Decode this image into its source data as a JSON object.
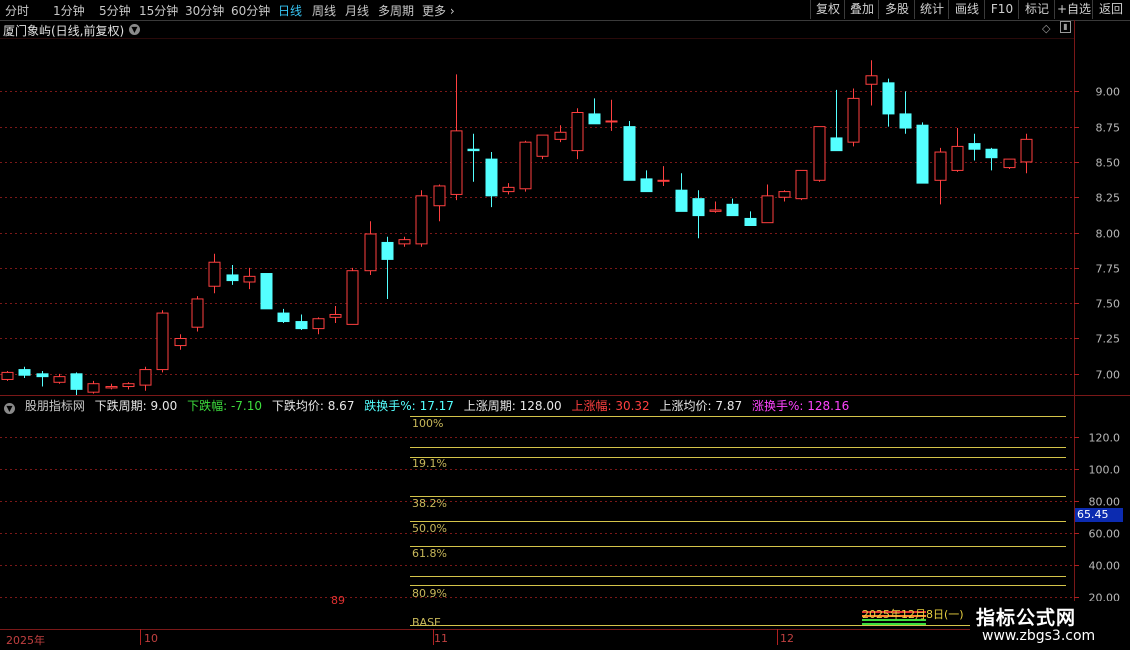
{
  "toolbar": {
    "periods": [
      "分时",
      "1分钟",
      "5分钟",
      "15分钟",
      "30分钟",
      "60分钟",
      "日线",
      "周线",
      "月线",
      "多周期",
      "更多"
    ],
    "active_period": "日线",
    "right_buttons": [
      "复权",
      "叠加",
      "多股",
      "统计",
      "画线",
      "F10",
      "标记",
      "+自选",
      "返回"
    ]
  },
  "chart": {
    "stock_title": "厦门象屿(日线,前复权)",
    "price_ticks": [
      "9.00",
      "8.75",
      "8.50",
      "8.25",
      "8.00",
      "7.75",
      "7.50",
      "7.25",
      "7.00"
    ],
    "date_labels": [
      "2025年",
      "10",
      "11",
      "12"
    ]
  },
  "indicator": {
    "name": "股朋指标网",
    "down_period_label": "下跌周期:",
    "down_period_value": "9.00",
    "down_change_label": "下跌幅:",
    "down_change_value": "-7.10",
    "down_avg_label": "下跌均价:",
    "down_avg_value": "8.67",
    "down_turnover_label": "跌换手%:",
    "down_turnover_value": "17.17",
    "up_period_label": "上涨周期:",
    "up_period_value": "128.00",
    "up_change_label": "上涨幅:",
    "up_change_value": "30.32",
    "up_avg_label": "上涨均价:",
    "up_avg_value": "7.87",
    "up_turnover_label": "涨换手%:",
    "up_turnover_value": "128.16",
    "fib_labels": [
      "100%",
      "19.1%",
      "38.2%",
      "50.0%",
      "61.8%",
      "80.9%",
      "BASE"
    ],
    "ticks": [
      "120.0",
      "100.0",
      "80.00",
      "60.00",
      "40.00",
      "20.00"
    ],
    "current_value": "65.45",
    "marker": "89",
    "date_note": "2025年12月8日(一)"
  },
  "watermark": {
    "line1": "指标公式网",
    "line2": "www.zbgs3.com"
  },
  "colors": {
    "up": "#ff4040",
    "down": "#54ffff",
    "active": "#36c5f4",
    "fib_line": "#d4c44a",
    "grid": "#7a1818"
  },
  "chart_data": {
    "type": "candlestick",
    "dates": [
      "2025-09-22",
      "2025-09-23",
      "2025-09-24",
      "2025-09-25",
      "2025-09-26",
      "2025-09-29",
      "2025-09-30",
      "2025-10-09",
      "2025-10-10",
      "2025-10-13",
      "2025-10-14",
      "2025-10-15",
      "2025-10-16",
      "2025-10-17",
      "2025-10-20",
      "2025-10-21",
      "2025-10-22",
      "2025-10-23",
      "2025-10-24",
      "2025-10-27",
      "2025-10-28",
      "2025-10-29",
      "2025-10-30",
      "2025-10-31",
      "2025-11-03",
      "2025-11-04",
      "2025-11-05",
      "2025-11-06",
      "2025-11-07",
      "2025-11-10",
      "2025-11-11",
      "2025-11-12",
      "2025-11-13",
      "2025-11-14",
      "2025-11-17",
      "2025-11-18",
      "2025-11-19",
      "2025-11-20",
      "2025-11-21",
      "2025-11-24",
      "2025-11-25",
      "2025-11-26",
      "2025-11-27",
      "2025-11-28",
      "2025-12-01",
      "2025-12-02",
      "2025-12-03",
      "2025-12-04",
      "2025-12-05",
      "2025-12-08",
      "2025-12-09",
      "2025-12-10",
      "2025-12-11",
      "2025-12-12",
      "2025-12-15",
      "2025-12-16",
      "2025-12-17",
      "2025-12-18",
      "2025-12-19",
      "2025-12-22",
      "2025-12-23"
    ],
    "ohlc": [
      [
        6.96,
        7.02,
        6.95,
        7.01
      ],
      [
        7.03,
        7.05,
        6.97,
        6.99
      ],
      [
        7.0,
        7.02,
        6.91,
        6.98
      ],
      [
        6.94,
        7.0,
        6.93,
        6.98
      ],
      [
        7.0,
        7.01,
        6.85,
        6.89
      ],
      [
        6.87,
        6.95,
        6.86,
        6.93
      ],
      [
        6.9,
        6.93,
        6.89,
        6.91
      ],
      [
        6.91,
        6.94,
        6.89,
        6.93
      ],
      [
        6.92,
        7.05,
        6.88,
        7.03
      ],
      [
        7.03,
        7.45,
        7.01,
        7.43
      ],
      [
        7.2,
        7.28,
        7.17,
        7.25
      ],
      [
        7.33,
        7.55,
        7.3,
        7.53
      ],
      [
        7.62,
        7.85,
        7.57,
        7.79
      ],
      [
        7.7,
        7.77,
        7.63,
        7.66
      ],
      [
        7.65,
        7.75,
        7.6,
        7.69
      ],
      [
        7.71,
        7.71,
        7.47,
        7.46
      ],
      [
        7.43,
        7.46,
        7.36,
        7.37
      ],
      [
        7.37,
        7.42,
        7.31,
        7.32
      ],
      [
        7.32,
        7.4,
        7.28,
        7.39
      ],
      [
        7.4,
        7.48,
        7.36,
        7.42
      ],
      [
        7.35,
        7.75,
        7.35,
        7.73
      ],
      [
        7.73,
        8.08,
        7.7,
        7.99
      ],
      [
        7.93,
        7.97,
        7.53,
        7.81
      ],
      [
        7.92,
        7.97,
        7.9,
        7.95
      ],
      [
        7.92,
        8.3,
        7.9,
        8.26
      ],
      [
        8.19,
        8.34,
        8.08,
        8.33
      ],
      [
        8.27,
        9.12,
        8.23,
        8.72
      ],
      [
        8.59,
        8.7,
        8.36,
        8.58
      ],
      [
        8.52,
        8.57,
        8.18,
        8.26
      ],
      [
        8.29,
        8.35,
        8.27,
        8.32
      ],
      [
        8.31,
        8.65,
        8.29,
        8.64
      ],
      [
        8.54,
        8.66,
        8.52,
        8.69
      ],
      [
        8.66,
        8.76,
        8.64,
        8.71
      ],
      [
        8.58,
        8.88,
        8.52,
        8.85
      ],
      [
        8.84,
        8.95,
        8.77,
        8.77
      ],
      [
        8.79,
        8.94,
        8.72,
        8.79
      ],
      [
        8.75,
        8.79,
        8.45,
        8.37
      ],
      [
        8.38,
        8.44,
        8.29,
        8.29
      ],
      [
        8.37,
        8.47,
        8.33,
        8.37
      ],
      [
        8.3,
        8.42,
        8.2,
        8.15
      ],
      [
        8.24,
        8.3,
        7.96,
        8.12
      ],
      [
        8.15,
        8.22,
        8.14,
        8.16
      ],
      [
        8.2,
        8.24,
        8.13,
        8.12
      ],
      [
        8.1,
        8.15,
        8.07,
        8.05
      ],
      [
        8.07,
        8.34,
        8.07,
        8.26
      ],
      [
        8.25,
        8.3,
        8.22,
        8.29
      ],
      [
        8.24,
        8.43,
        8.23,
        8.44
      ],
      [
        8.37,
        8.72,
        8.36,
        8.75
      ],
      [
        8.67,
        9.01,
        8.58,
        8.58
      ],
      [
        8.64,
        9.02,
        8.61,
        8.95
      ],
      [
        9.05,
        9.22,
        8.9,
        9.11
      ],
      [
        9.06,
        9.09,
        8.75,
        8.84
      ],
      [
        8.84,
        9.0,
        8.7,
        8.74
      ],
      [
        8.76,
        8.78,
        8.35,
        8.35
      ],
      [
        8.37,
        8.6,
        8.2,
        8.57
      ],
      [
        8.44,
        8.74,
        8.43,
        8.61
      ],
      [
        8.63,
        8.7,
        8.51,
        8.59
      ],
      [
        8.59,
        8.6,
        8.44,
        8.53
      ],
      [
        8.46,
        8.52,
        8.45,
        8.52
      ],
      [
        8.5,
        8.7,
        8.42,
        8.66
      ]
    ],
    "ylim": [
      6.85,
      9.25
    ],
    "yticks": [
      7.0,
      7.25,
      7.5,
      7.75,
      8.0,
      8.25,
      8.5,
      8.75,
      9.0
    ],
    "xlabels": [
      "2025年",
      "10",
      "11",
      "12"
    ],
    "indicator": {
      "ylim": [
        0,
        140
      ],
      "yticks": [
        20,
        40,
        60,
        80,
        100,
        120
      ],
      "fib_levels": [
        "100%",
        "19.1%",
        "38.2%",
        "50.0%",
        "61.8%",
        "80.9%",
        "BASE"
      ],
      "current": 65.45
    }
  }
}
